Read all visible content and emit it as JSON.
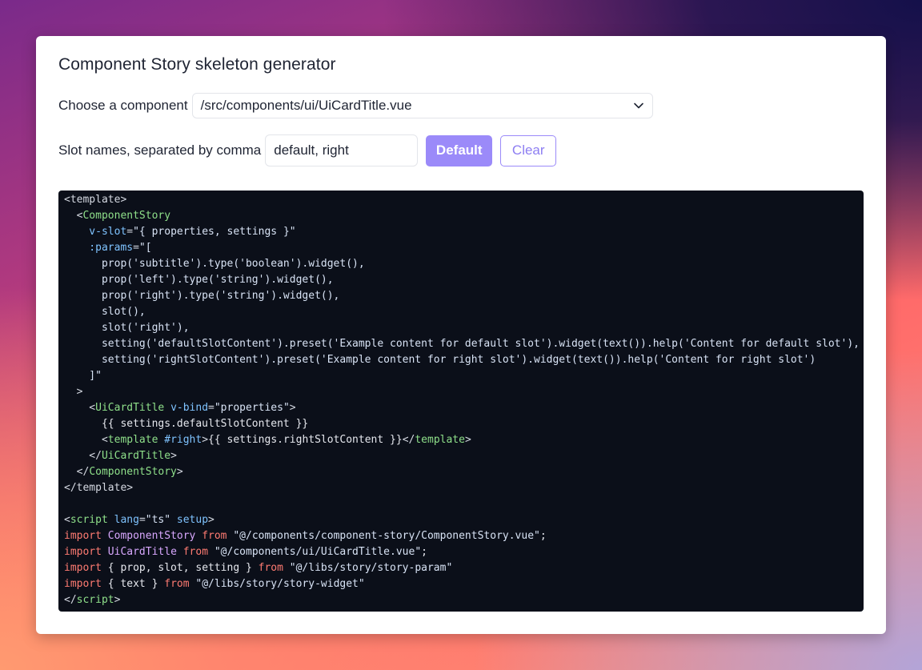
{
  "app": {
    "title": "Component Story skeleton generator"
  },
  "component_picker": {
    "label": "Choose a component",
    "selected": "/src/components/ui/UiCardTitle.vue",
    "icon": "chevron-down-icon"
  },
  "slots": {
    "label": "Slot names, separated by comma",
    "value": "default, right",
    "placeholder": "",
    "default_button": "Default",
    "clear_button": "Clear"
  },
  "colors": {
    "accent": "#9b8af9",
    "code_background": "#0b0f19"
  },
  "code": {
    "lines": [
      [
        [
          "pun",
          "<template>"
        ]
      ],
      [
        [
          "pun",
          "  <"
        ],
        [
          "tag",
          "ComponentStory"
        ]
      ],
      [
        [
          "attr",
          "    v-slot"
        ],
        [
          "pun",
          "="
        ],
        [
          "str",
          "\"{ properties, settings }\""
        ]
      ],
      [
        [
          "attr",
          "    :params"
        ],
        [
          "pun",
          "="
        ],
        [
          "str",
          "\"["
        ]
      ],
      [
        [
          "str",
          "      prop('subtitle').type('boolean').widget(),"
        ]
      ],
      [
        [
          "str",
          "      prop('left').type('string').widget(),"
        ]
      ],
      [
        [
          "str",
          "      prop('right').type('string').widget(),"
        ]
      ],
      [
        [
          "str",
          "      slot(),"
        ]
      ],
      [
        [
          "str",
          "      slot('right'),"
        ]
      ],
      [
        [
          "str",
          "      setting('defaultSlotContent').preset('Example content for default slot').widget(text()).help('Content for default slot'),"
        ]
      ],
      [
        [
          "str",
          "      setting('rightSlotContent').preset('Example content for right slot').widget(text()).help('Content for right slot')"
        ]
      ],
      [
        [
          "str",
          "    ]\""
        ]
      ],
      [
        [
          "pun",
          "  >"
        ]
      ],
      [
        [
          "pun",
          "    <"
        ],
        [
          "tag",
          "UiCardTitle"
        ],
        [
          "txt",
          " "
        ],
        [
          "attr",
          "v-bind"
        ],
        [
          "pun",
          "="
        ],
        [
          "str",
          "\"properties\""
        ],
        [
          "pun",
          ">"
        ]
      ],
      [
        [
          "txt",
          "      {{ settings.defaultSlotContent }}"
        ]
      ],
      [
        [
          "pun",
          "      <"
        ],
        [
          "tag",
          "template"
        ],
        [
          "txt",
          " "
        ],
        [
          "attr",
          "#right"
        ],
        [
          "pun",
          ">"
        ],
        [
          "txt",
          "{{ settings.rightSlotContent }}"
        ],
        [
          "pun",
          "</"
        ],
        [
          "tag",
          "template"
        ],
        [
          "pun",
          ">"
        ]
      ],
      [
        [
          "pun",
          "    </"
        ],
        [
          "tag",
          "UiCardTitle"
        ],
        [
          "pun",
          ">"
        ]
      ],
      [
        [
          "pun",
          "  </"
        ],
        [
          "tag",
          "ComponentStory"
        ],
        [
          "pun",
          ">"
        ]
      ],
      [
        [
          "pun",
          "</template>"
        ]
      ],
      [
        [
          "txt",
          " "
        ]
      ],
      [
        [
          "pun",
          "<"
        ],
        [
          "tag",
          "script"
        ],
        [
          "txt",
          " "
        ],
        [
          "attr",
          "lang"
        ],
        [
          "pun",
          "="
        ],
        [
          "str",
          "\"ts\""
        ],
        [
          "txt",
          " "
        ],
        [
          "attr",
          "setup"
        ],
        [
          "pun",
          ">"
        ]
      ],
      [
        [
          "kw",
          "import"
        ],
        [
          "txt",
          " "
        ],
        [
          "cls",
          "ComponentStory"
        ],
        [
          "txt",
          " "
        ],
        [
          "kw",
          "from"
        ],
        [
          "txt",
          " "
        ],
        [
          "str",
          "\"@/components/component-story/ComponentStory.vue\""
        ],
        [
          "txt",
          ";"
        ]
      ],
      [
        [
          "kw",
          "import"
        ],
        [
          "txt",
          " "
        ],
        [
          "cls",
          "UiCardTitle"
        ],
        [
          "txt",
          " "
        ],
        [
          "kw",
          "from"
        ],
        [
          "txt",
          " "
        ],
        [
          "str",
          "\"@/components/ui/UiCardTitle.vue\""
        ],
        [
          "txt",
          ";"
        ]
      ],
      [
        [
          "kw",
          "import"
        ],
        [
          "txt",
          " { prop, slot, setting } "
        ],
        [
          "kw",
          "from"
        ],
        [
          "txt",
          " "
        ],
        [
          "str",
          "\"@/libs/story/story-param\""
        ]
      ],
      [
        [
          "kw",
          "import"
        ],
        [
          "txt",
          " { text } "
        ],
        [
          "kw",
          "from"
        ],
        [
          "txt",
          " "
        ],
        [
          "str",
          "\"@/libs/story/story-widget\""
        ]
      ],
      [
        [
          "pun",
          "</"
        ],
        [
          "tag",
          "script"
        ],
        [
          "pun",
          ">"
        ]
      ]
    ]
  }
}
